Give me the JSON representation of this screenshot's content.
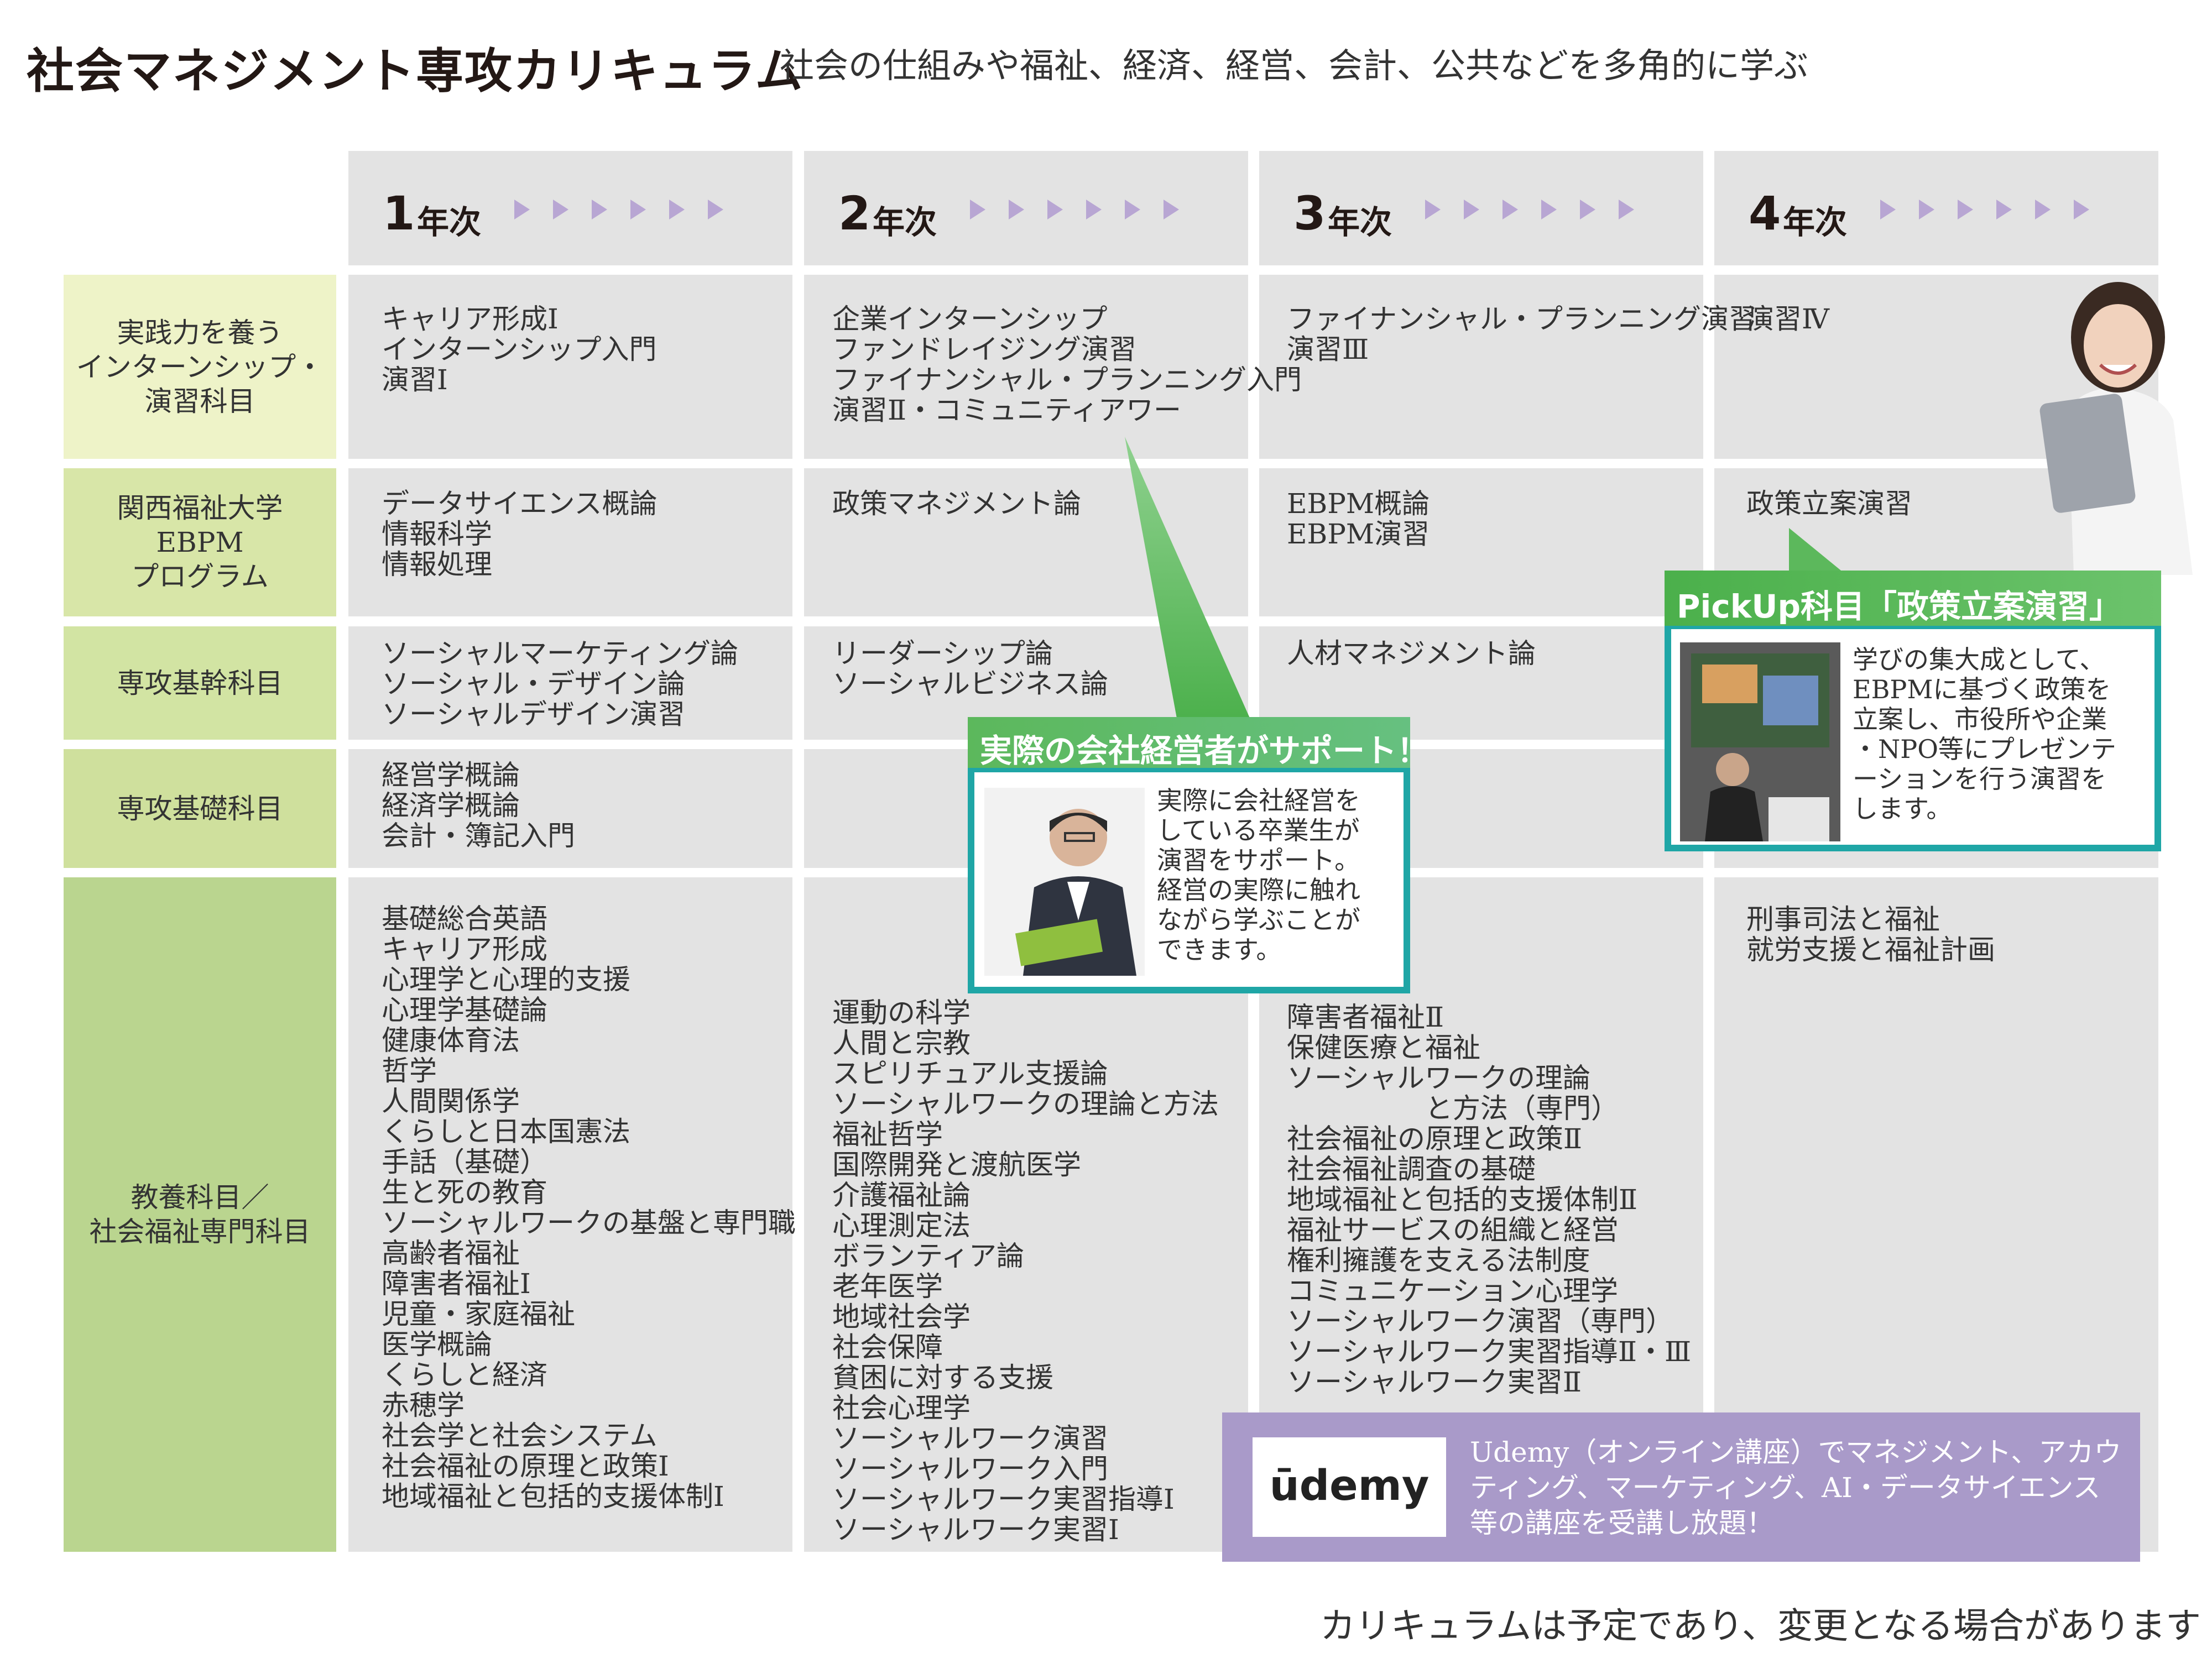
{
  "title": "社会マネジメント専攻カリキュラム",
  "subtitle": "社会の仕組みや福祉、経済、経営、会計、公共などを多角的に学ぶ",
  "years": [
    {
      "num": "1",
      "label": "年次"
    },
    {
      "num": "2",
      "label": "年次"
    },
    {
      "num": "3",
      "label": "年次"
    },
    {
      "num": "4",
      "label": "年次"
    }
  ],
  "rows": [
    {
      "label": "実践力を養う\nインターンシップ・\n演習科目",
      "cells": [
        "キャリア形成Ⅰ\nインターンシップ入門\n演習Ⅰ",
        "企業インターンシップ\nファンドレイジング演習\nファイナンシャル・プランニング入門\n演習Ⅱ・コミュニティアワー",
        "ファイナンシャル・プランニング演習\n演習Ⅲ",
        "演習Ⅳ"
      ]
    },
    {
      "label": "関西福祉大学\nEBPM\nプログラム",
      "cells": [
        "データサイエンス概論\n情報科学\n情報処理",
        "政策マネジメント論",
        "EBPM概論\nEBPM演習",
        "政策立案演習"
      ]
    },
    {
      "label": "専攻基幹科目",
      "cells": [
        "ソーシャルマーケティング論\nソーシャル・デザイン論\nソーシャルデザイン演習",
        "リーダーシップ論\nソーシャルビジネス論",
        "人材マネジメント論",
        ""
      ]
    },
    {
      "label": "専攻基礎科目",
      "cells": [
        "経営学概論\n経済学概論\n会計・簿記入門",
        "",
        "",
        ""
      ]
    },
    {
      "label": "教養科目／\n社会福祉専門科目",
      "cells": [
        "基礎総合英語\nキャリア形成\n心理学と心理的支援\n心理学基礎論\n健康体育法\n哲学\n人間関係学\nくらしと日本国憲法\n手話（基礎）\n生と死の教育\nソーシャルワークの基盤と専門職\n高齢者福祉\n障害者福祉Ⅰ\n児童・家庭福祉\n医学概論\nくらしと経済\n赤穂学\n社会学と社会システム\n社会福祉の原理と政策Ⅰ\n地域福祉と包括的支援体制Ⅰ",
        "運動の科学\n人間と宗教\nスピリチュアル支援論\nソーシャルワークの理論と方法\n福祉哲学\n国際開発と渡航医学\n介護福祉論\n心理測定法\nボランティア論\n老年医学\n地域社会学\n社会保障\n貧困に対する支援\n社会心理学\nソーシャルワーク演習\nソーシャルワーク入門\nソーシャルワーク実習指導Ⅰ\nソーシャルワーク実習Ⅰ",
        "障害者福祉Ⅱ\n保健医療と福祉\nソーシャルワークの理論\n　　　　　と方法（専門）\n社会福祉の原理と政策Ⅱ\n社会福祉調査の基礎\n地域福祉と包括的支援体制Ⅱ\n福祉サービスの組織と経営\n権利擁護を支える法制度\nコミュニケーション心理学\nソーシャルワーク演習（専門）\nソーシャルワーク実習指導Ⅱ・Ⅲ\nソーシャルワーク実習Ⅱ",
        "刑事司法と福祉\n就労支援と福祉計画"
      ]
    }
  ],
  "callout_support": {
    "title": "実際の会社経営者がサポート！",
    "text": "実際に会社経営を\nしている卒業生が\n演習をサポート。\n経営の実際に触れ\nながら学ぶことが\nできます。"
  },
  "callout_pickup": {
    "title": "PickUp科目「政策立案演習」",
    "text": "学びの集大成として、\nEBPMに基づく政策を\n立案し、市役所や企業\n・NPO等にプレゼンテ\nーションを行う演習を\nします。"
  },
  "udemy": {
    "logo": "ūdemy",
    "text": "Udemy（オンライン講座）でマネジメント、アカウ\nティング、マーケティング、AI・データサイエンス\n等の講座を受講し放題！"
  },
  "footer": "カリキュラムは予定であり、変更となる場合があります",
  "colors": {
    "cell_gray": "#e3e3e3",
    "row1_label": "#eef3c8",
    "row2_label": "#d8e6a8",
    "row3_label": "#d2e4a3",
    "row4_label": "#cfe09d",
    "row5_label": "#bad58f",
    "arrow": "#b8a6d3",
    "green_callout": "#5cb85c",
    "teal_border": "#1fa6a6",
    "udemy_purple": "#a99ac9"
  }
}
